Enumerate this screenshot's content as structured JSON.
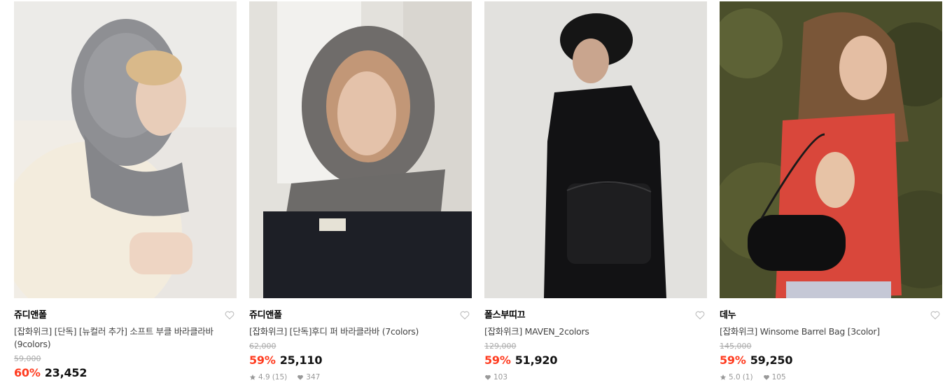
{
  "products": [
    {
      "brand": "쥬디앤폴",
      "title": "[잡화위크] [단독] [뉴컬러 추가] 소프트 부클 바라클라바 (9colors)",
      "original_price": "59,000",
      "discount": "60%",
      "price": "23,452",
      "rating": "",
      "review_count": "",
      "likes": "",
      "image_desc": "model-gray-boucle-balaclava"
    },
    {
      "brand": "쥬디앤폴",
      "title": "[잡화위크] [단독]후디 퍼 바라클라바 (7colors)",
      "original_price": "62,000",
      "discount": "59%",
      "price": "25,110",
      "rating": "4.9",
      "review_count": "(15)",
      "likes": "347",
      "image_desc": "model-gray-fur-hood"
    },
    {
      "brand": "폴스부띠끄",
      "title": "[잡화위크] MAVEN_2colors",
      "original_price": "129,000",
      "discount": "59%",
      "price": "51,920",
      "rating": "",
      "review_count": "",
      "likes": "103",
      "image_desc": "model-black-coat-shoulder-bag"
    },
    {
      "brand": "데누",
      "title": "[잡화위크] Winsome Barrel Bag [3color]",
      "original_price": "145,000",
      "discount": "59%",
      "price": "59,250",
      "rating": "5.0",
      "review_count": "(1)",
      "likes": "105",
      "image_desc": "model-red-top-barrel-bag"
    }
  ],
  "colors": {
    "discount": "#ff3b1f",
    "muted": "#999999",
    "strike": "#aaaaaa",
    "title_text": "#444444"
  },
  "icons": {
    "wishlist": "heart-outline-icon",
    "rating": "star-icon",
    "likes": "heart-filled-icon"
  }
}
